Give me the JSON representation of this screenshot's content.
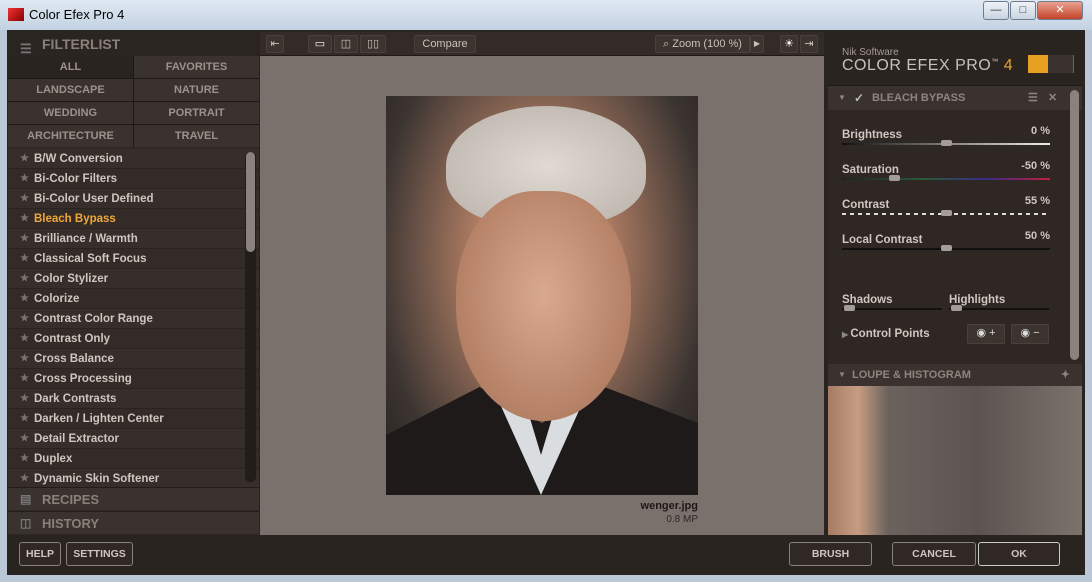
{
  "window": {
    "title": "Color Efex Pro 4",
    "min": "—",
    "max": "□",
    "close": "✕"
  },
  "filterlist": {
    "title": "FILTERLIST",
    "categories": [
      "ALL",
      "FAVORITES",
      "LANDSCAPE",
      "NATURE",
      "WEDDING",
      "PORTRAIT",
      "ARCHITECTURE",
      "TRAVEL"
    ],
    "selected_category": "ALL",
    "filters": [
      "B/W Conversion",
      "Bi-Color Filters",
      "Bi-Color User Defined",
      "Bleach Bypass",
      "Brilliance / Warmth",
      "Classical Soft Focus",
      "Color Stylizer",
      "Colorize",
      "Contrast Color Range",
      "Contrast Only",
      "Cross Balance",
      "Cross Processing",
      "Dark Contrasts",
      "Darken / Lighten Center",
      "Detail Extractor",
      "Duplex",
      "Dynamic Skin Softener"
    ],
    "selected_filter": "Bleach Bypass"
  },
  "recipes": "RECIPES",
  "history": "HISTORY",
  "toolbar": {
    "compare": "Compare",
    "zoom": "Zoom (100 %)"
  },
  "image": {
    "filename": "wenger.jpg",
    "size": "0.8 MP"
  },
  "brand": {
    "company": "Nik Software",
    "product": "COLOR EFEX PRO",
    "tm": "™",
    "version": "4"
  },
  "filter_panel": {
    "title": "BLEACH BYPASS",
    "enabled": true,
    "sliders": [
      {
        "label": "Brightness",
        "value": "0 %",
        "pos": 0.5
      },
      {
        "label": "Saturation",
        "value": "-50 %",
        "pos": 0.25
      },
      {
        "label": "Contrast",
        "value": "55 %",
        "pos": 0.5
      },
      {
        "label": "Local Contrast",
        "value": "50 %",
        "pos": 0.5
      }
    ],
    "shadows": "Shadows",
    "highlights": "Highlights",
    "control_points": "Control Points"
  },
  "loupe": {
    "title": "LOUPE & HISTOGRAM"
  },
  "buttons": {
    "help": "HELP",
    "settings": "SETTINGS",
    "brush": "BRUSH",
    "cancel": "CANCEL",
    "ok": "OK"
  },
  "colors": {
    "accent": "#f0a83a"
  }
}
